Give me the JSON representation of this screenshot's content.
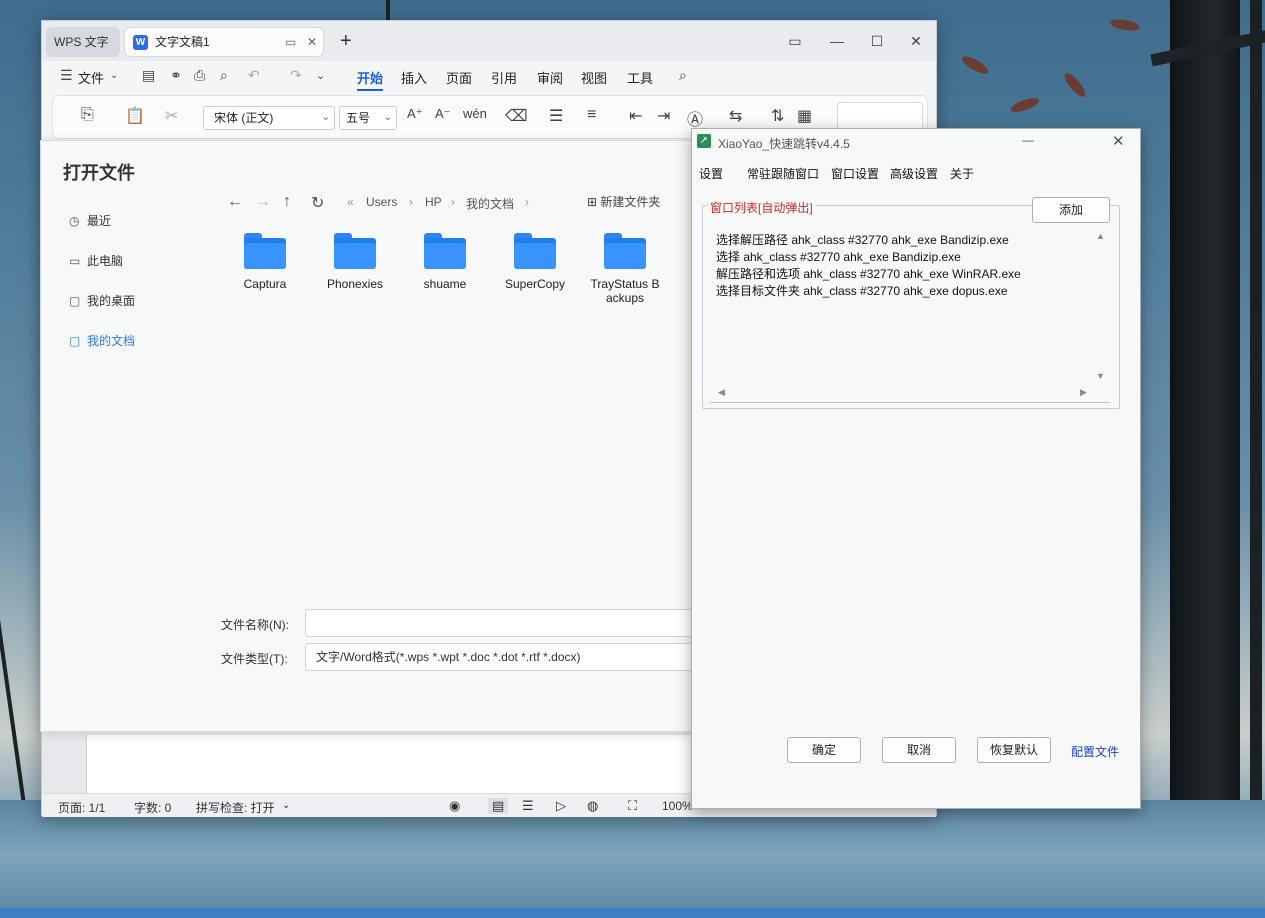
{
  "wps": {
    "tabs": {
      "home_tab": "WPS 文字",
      "doc_tab": "文字文稿1"
    },
    "menu": {
      "file": "文件",
      "items": [
        "开始",
        "插入",
        "页面",
        "引用",
        "审阅",
        "视图",
        "工具"
      ]
    },
    "ribbon": {
      "font": "宋体 (正文)",
      "font_size": "五号"
    },
    "status": {
      "page": "页面: 1/1",
      "words": "字数: 0",
      "spell": "拼写检查: 打开",
      "zoom": "100%"
    }
  },
  "open_dialog": {
    "title": "打开文件",
    "nav": [
      "最近",
      "此电脑",
      "我的桌面",
      "我的文档"
    ],
    "breadcrumb": [
      "Users",
      "HP",
      "我的文档"
    ],
    "new_folder": "新建文件夹",
    "folders": [
      "Captura",
      "Phonexies",
      "shuame",
      "SuperCopy",
      "TrayStatus B\nackups"
    ],
    "filename_label": "文件名称(N):",
    "filename_value": "",
    "filetype_label": "文件类型(T):",
    "filetype_value": "文字/Word格式(*.wps *.wpt *.doc *.dot *.rtf *.docx)"
  },
  "xiaoyao": {
    "title": "XiaoYao_快速跳转v4.4.5",
    "tabs": [
      "设置",
      "常驻跟随窗口",
      "窗口设置",
      "高级设置",
      "关于"
    ],
    "group_legend": "窗口列表[自动弹出]",
    "add_button": "添加",
    "list": [
      "选择解压路径 ahk_class #32770 ahk_exe Bandizip.exe",
      "选择 ahk_class #32770 ahk_exe Bandizip.exe",
      "解压路径和选项 ahk_class #32770 ahk_exe WinRAR.exe",
      "选择目标文件夹 ahk_class #32770 ahk_exe dopus.exe"
    ],
    "buttons": {
      "ok": "确定",
      "cancel": "取消",
      "reset": "恢复默认",
      "config": "配置文件"
    },
    "colors": {
      "legend": "#d4272b",
      "link": "#1b3fd1"
    }
  }
}
